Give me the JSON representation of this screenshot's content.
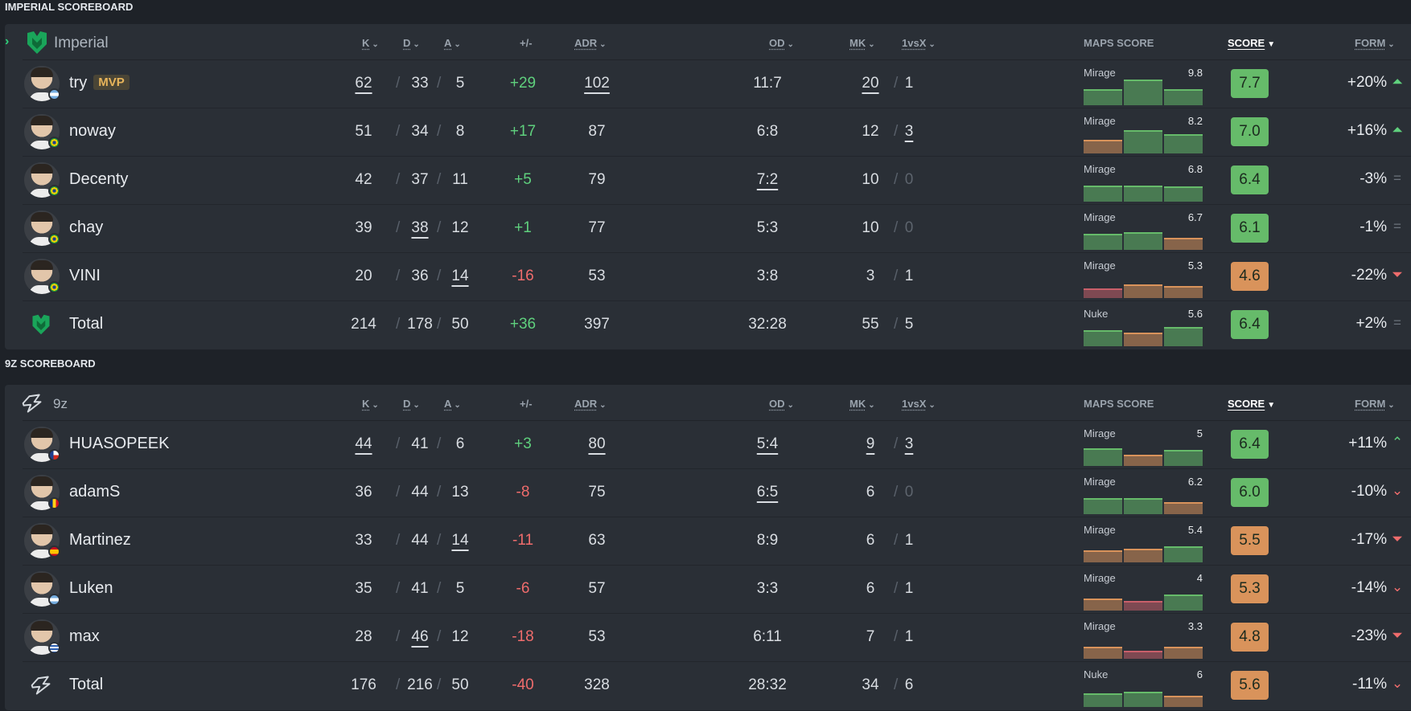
{
  "colors": {
    "green": "#66bb6a",
    "orange": "#d9935b",
    "red": "#c95f6a"
  },
  "sections": [
    {
      "title": "IMPERIAL SCOREBOARD",
      "team": "Imperial",
      "expand_icon": "chevron-right-icon",
      "logo_icon": "imperial-logo-icon",
      "headers": {
        "k": "K",
        "d": "D",
        "a": "A",
        "pm": "+/-",
        "adr": "ADR",
        "od": "OD",
        "mk": "MK",
        "vsx": "1vsX",
        "maps": "MAPS SCORE",
        "score": "SCORE",
        "form": "FORM"
      },
      "players": [
        {
          "name": "try",
          "badge": "MVP",
          "flag": "ar",
          "k": "62",
          "d": "33",
          "a": "5",
          "pm": "+29",
          "adr": "102",
          "od": "11:7",
          "mk": "20",
          "vsx": "1",
          "map": "Mirage",
          "map_score": "9.8",
          "bars": [
            "green",
            "green",
            "green"
          ],
          "bar_heights": [
            0.6,
            0.95,
            0.6
          ],
          "score": "7.7",
          "score_color": "green",
          "form": "+20%",
          "form_icon": "double-up-icon",
          "ul": {
            "k": true,
            "d": false,
            "a": false,
            "adr": true,
            "od": false,
            "mk": true,
            "vsx": false
          },
          "vsx_dim": false
        },
        {
          "name": "noway",
          "badge": "",
          "flag": "br",
          "k": "51",
          "d": "34",
          "a": "8",
          "pm": "+17",
          "adr": "87",
          "od": "6:8",
          "mk": "12",
          "vsx": "3",
          "map": "Mirage",
          "map_score": "8.2",
          "bars": [
            "orange",
            "green",
            "green"
          ],
          "bar_heights": [
            0.5,
            0.85,
            0.7
          ],
          "score": "7.0",
          "score_color": "green",
          "form": "+16%",
          "form_icon": "double-up-icon",
          "ul": {
            "k": false,
            "d": false,
            "a": false,
            "adr": false,
            "od": false,
            "mk": false,
            "vsx": true
          },
          "vsx_dim": false
        },
        {
          "name": "Decenty",
          "badge": "",
          "flag": "br",
          "k": "42",
          "d": "37",
          "a": "11",
          "pm": "+5",
          "adr": "79",
          "od": "7:2",
          "mk": "10",
          "vsx": "0",
          "map": "Mirage",
          "map_score": "6.8",
          "bars": [
            "green",
            "green",
            "green"
          ],
          "bar_heights": [
            0.6,
            0.6,
            0.55
          ],
          "score": "6.4",
          "score_color": "green",
          "form": "-3%",
          "form_icon": "equal-icon",
          "ul": {
            "k": false,
            "d": false,
            "a": false,
            "adr": false,
            "od": true,
            "mk": false,
            "vsx": false
          },
          "vsx_dim": true
        },
        {
          "name": "chay",
          "badge": "",
          "flag": "br",
          "k": "39",
          "d": "38",
          "a": "12",
          "pm": "+1",
          "adr": "77",
          "od": "5:3",
          "mk": "10",
          "vsx": "0",
          "map": "Mirage",
          "map_score": "6.7",
          "bars": [
            "green",
            "green",
            "orange"
          ],
          "bar_heights": [
            0.6,
            0.65,
            0.45
          ],
          "score": "6.1",
          "score_color": "green",
          "form": "-1%",
          "form_icon": "equal-icon",
          "ul": {
            "k": false,
            "d": true,
            "a": false,
            "adr": false,
            "od": false,
            "mk": false,
            "vsx": false
          },
          "vsx_dim": true
        },
        {
          "name": "VINI",
          "badge": "",
          "flag": "br",
          "k": "20",
          "d": "36",
          "a": "14",
          "pm": "-16",
          "adr": "53",
          "od": "3:8",
          "mk": "3",
          "vsx": "1",
          "map": "Mirage",
          "map_score": "5.3",
          "bars": [
            "red",
            "orange",
            "orange"
          ],
          "bar_heights": [
            0.35,
            0.5,
            0.45
          ],
          "score": "4.6",
          "score_color": "orange",
          "form": "-22%",
          "form_icon": "double-down-icon",
          "ul": {
            "k": false,
            "d": false,
            "a": true,
            "adr": false,
            "od": false,
            "mk": false,
            "vsx": false
          },
          "vsx_dim": false
        }
      ],
      "total": {
        "name": "Total",
        "k": "214",
        "d": "178",
        "a": "50",
        "pm": "+36",
        "adr": "397",
        "od": "32:28",
        "mk": "55",
        "vsx": "5",
        "map": "Nuke",
        "map_score": "5.6",
        "bars": [
          "green",
          "orange",
          "green"
        ],
        "bar_heights": [
          0.6,
          0.5,
          0.7
        ],
        "score": "6.4",
        "score_color": "green",
        "form": "+2%",
        "form_icon": "equal-icon"
      }
    },
    {
      "title": "9Z SCOREBOARD",
      "team": "9z",
      "expand_icon": "",
      "logo_icon": "9z-logo-icon",
      "headers": {
        "k": "K",
        "d": "D",
        "a": "A",
        "pm": "+/-",
        "adr": "ADR",
        "od": "OD",
        "mk": "MK",
        "vsx": "1vsX",
        "maps": "MAPS SCORE",
        "score": "SCORE",
        "form": "FORM"
      },
      "players": [
        {
          "name": "HUASOPEEK",
          "badge": "",
          "flag": "cl",
          "k": "44",
          "d": "41",
          "a": "6",
          "pm": "+3",
          "adr": "80",
          "od": "5:4",
          "mk": "9",
          "vsx": "3",
          "map": "Mirage",
          "map_score": "5",
          "bars": [
            "green",
            "orange",
            "green"
          ],
          "bar_heights": [
            0.65,
            0.4,
            0.6
          ],
          "score": "6.4",
          "score_color": "green",
          "form": "+11%",
          "form_icon": "up-icon",
          "ul": {
            "k": true,
            "d": false,
            "a": false,
            "adr": true,
            "od": true,
            "mk": true,
            "vsx": true
          },
          "vsx_dim": false
        },
        {
          "name": "adamS",
          "badge": "",
          "flag": "ro",
          "k": "36",
          "d": "44",
          "a": "13",
          "pm": "-8",
          "adr": "75",
          "od": "6:5",
          "mk": "6",
          "vsx": "0",
          "map": "Mirage",
          "map_score": "6.2",
          "bars": [
            "green",
            "green",
            "orange"
          ],
          "bar_heights": [
            0.6,
            0.6,
            0.45
          ],
          "score": "6.0",
          "score_color": "green",
          "form": "-10%",
          "form_icon": "down-icon",
          "ul": {
            "k": false,
            "d": false,
            "a": false,
            "adr": false,
            "od": true,
            "mk": false,
            "vsx": false
          },
          "vsx_dim": true
        },
        {
          "name": "Martinez",
          "badge": "",
          "flag": "es",
          "k": "33",
          "d": "44",
          "a": "14",
          "pm": "-11",
          "adr": "63",
          "od": "8:9",
          "mk": "6",
          "vsx": "1",
          "map": "Mirage",
          "map_score": "5.4",
          "bars": [
            "orange",
            "orange",
            "green"
          ],
          "bar_heights": [
            0.45,
            0.5,
            0.6
          ],
          "score": "5.5",
          "score_color": "orange",
          "form": "-17%",
          "form_icon": "double-down-icon",
          "ul": {
            "k": false,
            "d": false,
            "a": true,
            "adr": false,
            "od": false,
            "mk": false,
            "vsx": false
          },
          "vsx_dim": false
        },
        {
          "name": "Luken",
          "badge": "",
          "flag": "ar",
          "k": "35",
          "d": "41",
          "a": "5",
          "pm": "-6",
          "adr": "57",
          "od": "3:3",
          "mk": "6",
          "vsx": "1",
          "map": "Mirage",
          "map_score": "4",
          "bars": [
            "orange",
            "red",
            "green"
          ],
          "bar_heights": [
            0.45,
            0.35,
            0.6
          ],
          "score": "5.3",
          "score_color": "orange",
          "form": "-14%",
          "form_icon": "down-icon",
          "ul": {
            "k": false,
            "d": false,
            "a": false,
            "adr": false,
            "od": false,
            "mk": false,
            "vsx": false
          },
          "vsx_dim": false
        },
        {
          "name": "max",
          "badge": "",
          "flag": "uy",
          "k": "28",
          "d": "46",
          "a": "12",
          "pm": "-18",
          "adr": "53",
          "od": "6:11",
          "mk": "7",
          "vsx": "1",
          "map": "Mirage",
          "map_score": "3.3",
          "bars": [
            "orange",
            "red",
            "orange"
          ],
          "bar_heights": [
            0.45,
            0.3,
            0.45
          ],
          "score": "4.8",
          "score_color": "orange",
          "form": "-23%",
          "form_icon": "double-down-icon",
          "ul": {
            "k": false,
            "d": true,
            "a": false,
            "adr": false,
            "od": false,
            "mk": false,
            "vsx": false
          },
          "vsx_dim": false
        }
      ],
      "total": {
        "name": "Total",
        "k": "176",
        "d": "216",
        "a": "50",
        "pm": "-40",
        "adr": "328",
        "od": "28:32",
        "mk": "34",
        "vsx": "6",
        "map": "Nuke",
        "map_score": "6",
        "bars": [
          "green",
          "green",
          "orange"
        ],
        "bar_heights": [
          0.5,
          0.55,
          0.4
        ],
        "score": "5.6",
        "score_color": "orange",
        "form": "-11%",
        "form_icon": "down-icon"
      }
    }
  ]
}
